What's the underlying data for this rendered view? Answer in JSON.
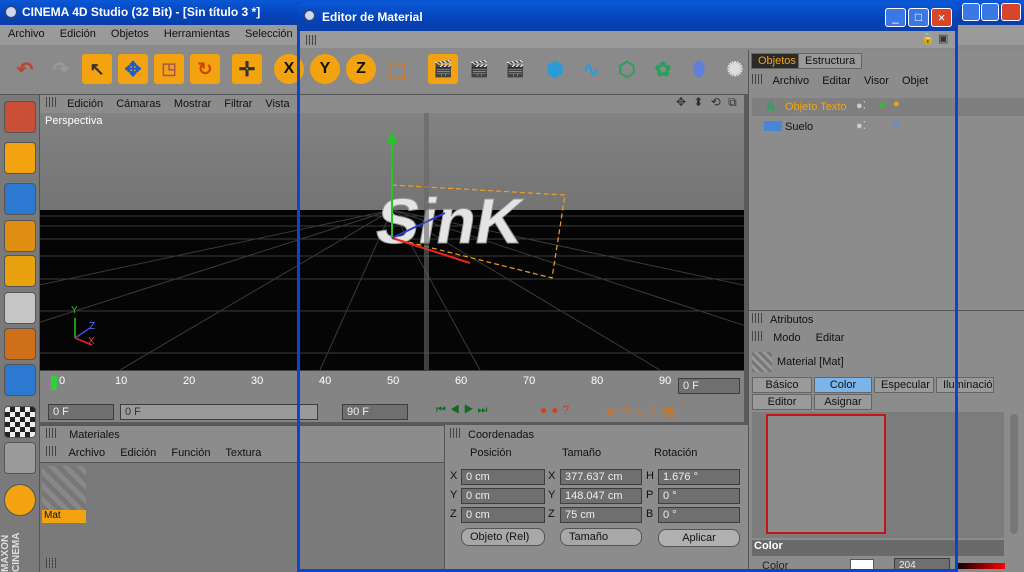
{
  "app": {
    "title": "CINEMA 4D Studio (32 Bit) - [Sin título 3 *]"
  },
  "menubar": [
    "Archivo",
    "Edición",
    "Objetos",
    "Herramientas",
    "Selección"
  ],
  "viewport": {
    "menu": [
      "Edición",
      "Cámaras",
      "Mostrar",
      "Filtrar",
      "Vista"
    ],
    "label": "Perspectiva",
    "text3d": "SinK"
  },
  "timeline": {
    "ticks": [
      "0",
      "10",
      "20",
      "30",
      "40",
      "50",
      "60",
      "70",
      "80",
      "90"
    ],
    "current": "0 F",
    "start": "0 F",
    "range_start": "0 F",
    "range_end": "90 F",
    "end": "90 F"
  },
  "materials": {
    "title": "Materiales",
    "menu": [
      "Archivo",
      "Edición",
      "Función",
      "Textura"
    ],
    "items": [
      {
        "name": "Mat"
      }
    ]
  },
  "coords": {
    "title": "Coordenadas",
    "headers": [
      "Posición",
      "Tamaño",
      "Rotación"
    ],
    "rows": [
      {
        "axis": "X",
        "pos": "0 cm",
        "saxis": "X",
        "size": "377.637 cm",
        "raxis": "H",
        "rot": "1.676 °"
      },
      {
        "axis": "Y",
        "pos": "0 cm",
        "saxis": "Y",
        "size": "148.047 cm",
        "raxis": "P",
        "rot": "0 °"
      },
      {
        "axis": "Z",
        "pos": "0 cm",
        "saxis": "Z",
        "size": "75 cm",
        "raxis": "B",
        "rot": "0 °"
      }
    ],
    "mode": "Objeto (Rel)",
    "size_mode": "Tamaño",
    "apply": "Aplicar"
  },
  "objects": {
    "tabs": [
      "Objetos",
      "Estructura"
    ],
    "menu": [
      "Archivo",
      "Editar",
      "Visor",
      "Objet"
    ],
    "items": [
      {
        "name": "Objeto Texto"
      },
      {
        "name": "Suelo"
      }
    ]
  },
  "attributes": {
    "title": "Atributos",
    "menu": [
      "Modo",
      "Editar"
    ],
    "material": "Material [Mat]",
    "tabs_row1": [
      "Básico",
      "Color",
      "Especular",
      "Iluminación"
    ],
    "tabs_row2": [
      "Editor",
      "Asignar"
    ],
    "section": "Color",
    "prop": "Color",
    "prop_value": "204"
  },
  "dialog": {
    "title": "Editor de Material"
  },
  "colors": {
    "xp_blue": "#0a58d6",
    "accent": "#f3a310"
  },
  "watermark": "MAXON CINEMA"
}
